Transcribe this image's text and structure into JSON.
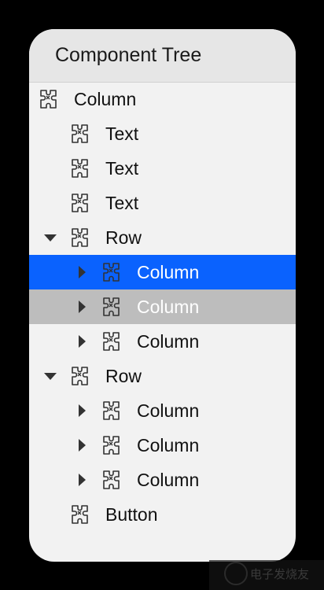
{
  "panel": {
    "title": "Component Tree"
  },
  "tree": [
    {
      "label": "Column",
      "level": 0,
      "arrow": "none",
      "state": "normal"
    },
    {
      "label": "Text",
      "level": 1,
      "arrow": "none",
      "state": "normal"
    },
    {
      "label": "Text",
      "level": 1,
      "arrow": "none",
      "state": "normal"
    },
    {
      "label": "Text",
      "level": 1,
      "arrow": "none",
      "state": "normal"
    },
    {
      "label": "Row",
      "level": 1,
      "arrow": "expanded",
      "state": "normal"
    },
    {
      "label": "Column",
      "level": 2,
      "arrow": "collapsed",
      "state": "selected"
    },
    {
      "label": "Column",
      "level": 2,
      "arrow": "collapsed",
      "state": "hover"
    },
    {
      "label": "Column",
      "level": 2,
      "arrow": "collapsed",
      "state": "normal"
    },
    {
      "label": "Row",
      "level": 1,
      "arrow": "expanded",
      "state": "normal"
    },
    {
      "label": "Column",
      "level": 2,
      "arrow": "collapsed",
      "state": "normal"
    },
    {
      "label": "Column",
      "level": 2,
      "arrow": "collapsed",
      "state": "normal"
    },
    {
      "label": "Column",
      "level": 2,
      "arrow": "collapsed",
      "state": "normal"
    },
    {
      "label": "Button",
      "level": 1,
      "arrow": "none",
      "state": "normal"
    }
  ],
  "icons": {
    "node": "puzzle-piece-icon"
  },
  "colors": {
    "selected": "#0a62fe",
    "hover": "#bdbdbd",
    "panel_bg": "#f2f2f2",
    "header_bg": "#e6e6e6"
  },
  "watermark": {
    "text": "电子发烧友"
  }
}
